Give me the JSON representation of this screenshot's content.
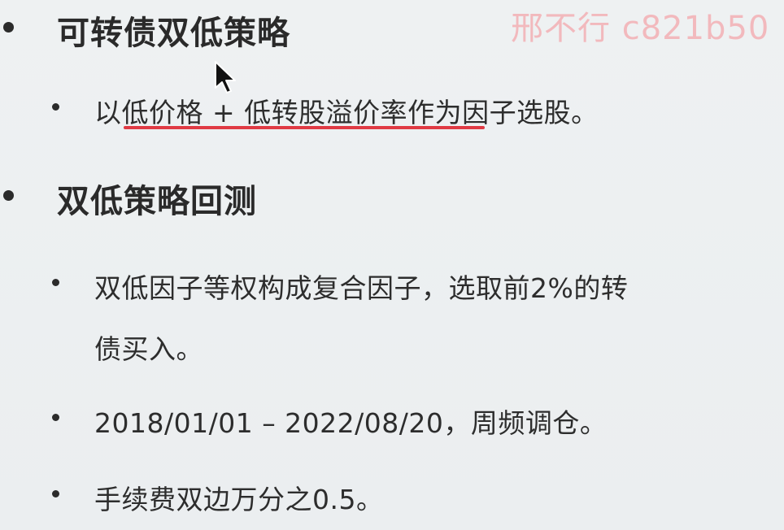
{
  "watermark": "邢不行 c821b50",
  "sections": [
    {
      "heading": "可转债双低策略",
      "items": [
        {
          "text": "以低价格 + 低转股溢价率作为因子选股。"
        }
      ]
    },
    {
      "heading": "双低策略回测",
      "items": [
        {
          "line1": "双低因子等权构成复合因子，选取前2%的转",
          "line2": "债买入。"
        },
        {
          "text": "2018/01/01 – 2022/08/20，周频调仓。"
        },
        {
          "text": "手续费双边万分之0.5。"
        }
      ]
    }
  ],
  "colors": {
    "underline": "#e03a44",
    "watermark": "#f2b9bd"
  },
  "icons": {
    "cursor": "mouse-pointer-icon"
  }
}
